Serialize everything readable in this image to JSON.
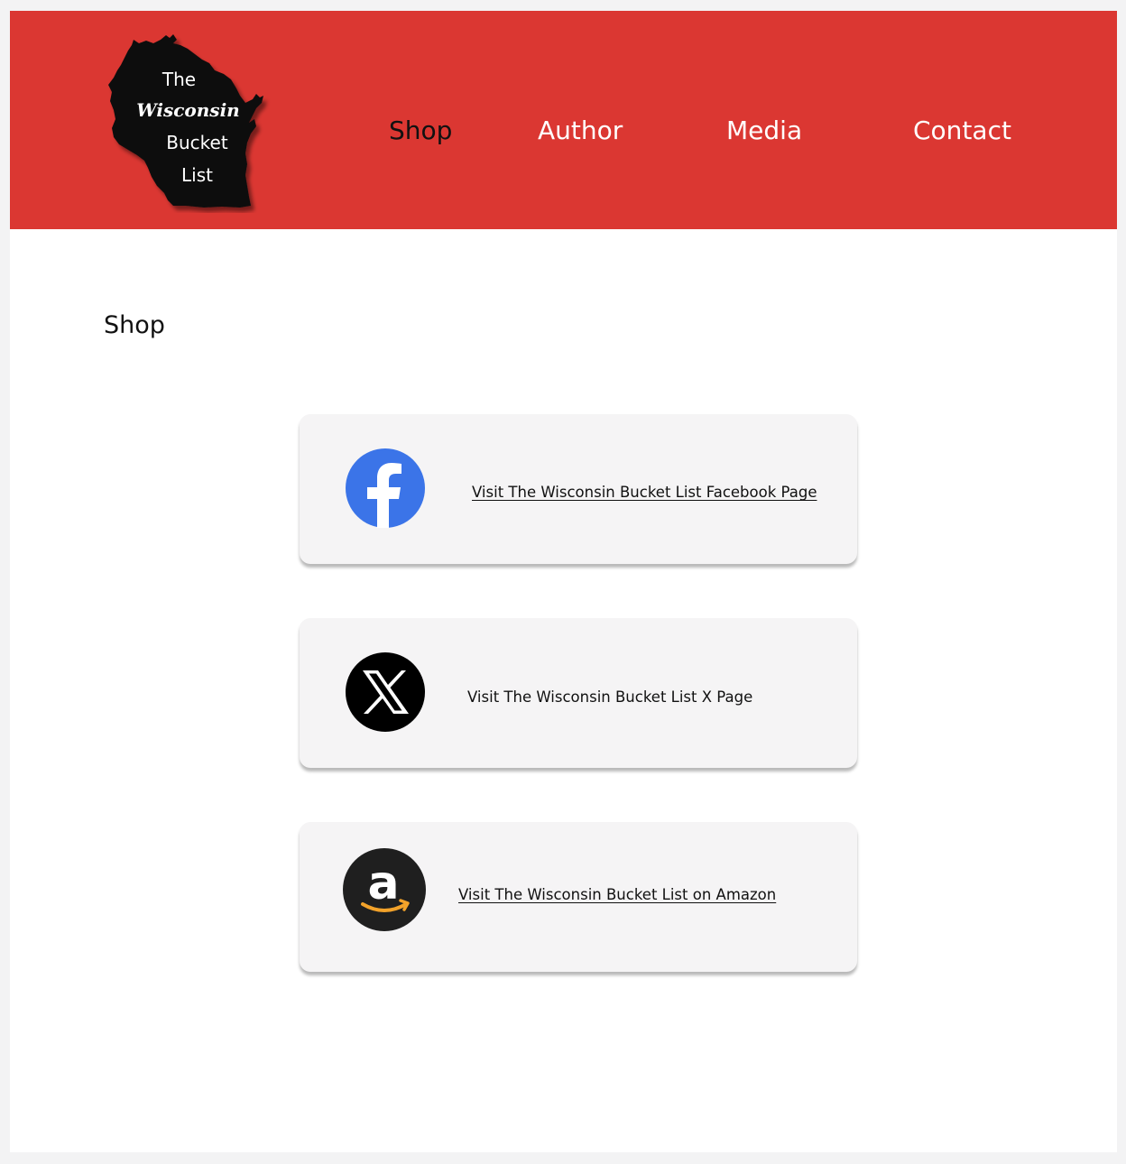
{
  "logo": {
    "line1": "The",
    "line2": "Wisconsin",
    "line3": "Bucket",
    "line4": "List"
  },
  "nav": {
    "items": [
      {
        "label": "Shop",
        "active": true
      },
      {
        "label": "Author",
        "active": false
      },
      {
        "label": "Media",
        "active": false
      },
      {
        "label": "Contact",
        "active": false
      }
    ]
  },
  "main": {
    "title": "Shop",
    "cards": [
      {
        "icon": "facebook-icon",
        "label": "Visit The Wisconsin Bucket List Facebook Page",
        "underlined": true
      },
      {
        "icon": "x-icon",
        "label": "Visit The Wisconsin Bucket List X Page",
        "underlined": false
      },
      {
        "icon": "amazon-icon",
        "label": "Visit The Wisconsin Bucket List on Amazon",
        "underlined": true
      }
    ]
  },
  "colors": {
    "header_bg": "#db3732",
    "card_bg": "#f5f4f5",
    "facebook_blue": "#3b74e8",
    "amazon_orange": "#f2a22a"
  }
}
